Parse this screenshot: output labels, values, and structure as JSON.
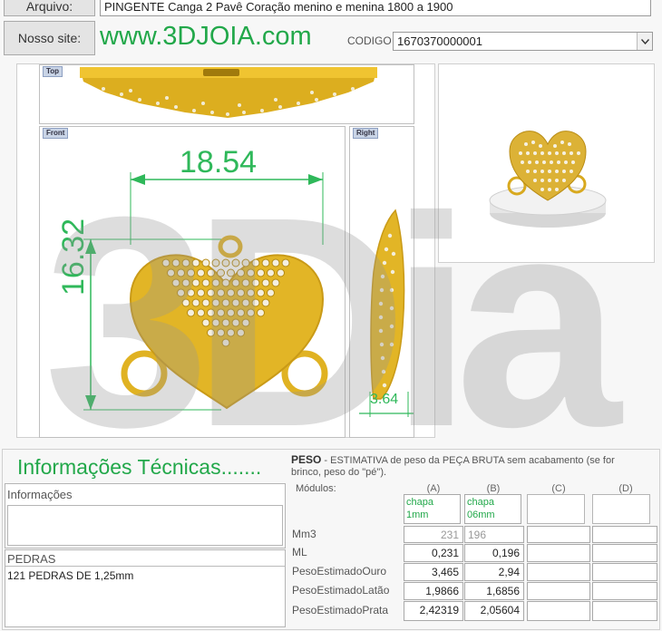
{
  "header": {
    "arquivo_label": "Arquivo:",
    "arquivo_value": "PINGENTE Canga 2 Pavê Coração menino e menina 1800 a 1900",
    "site_button": "Nosso site:",
    "site_url": "www.3DJOIA.com",
    "codigo_label": "CODIGO",
    "codigo_value": "1670370000001"
  },
  "viewports": {
    "top_label": "Top",
    "front_label": "Front",
    "right_label": "Right",
    "width_dim": "18.54",
    "height_dim": "16.32",
    "depth_dim": "3.64"
  },
  "watermark": "3Dia",
  "info": {
    "title": "Informações Técnicas.......",
    "informacoes_label": "Informações",
    "pedras_label": "PEDRAS",
    "pedras_value": "121 PEDRAS DE 1,25mm"
  },
  "peso": {
    "title": "PESO",
    "description": " -  ESTIMATIVA de peso da PEÇA BRUTA sem acabamento (se for brinco, peso do \"pé\").",
    "modulos_label": "Módulos:",
    "columns": [
      "(A)",
      "(B)",
      "(C)",
      "(D)"
    ],
    "chapa": [
      "chapa 1mm",
      "chapa 06mm"
    ],
    "rows": [
      {
        "label": "Mm3",
        "a": "231",
        "b": "196"
      },
      {
        "label": "ML",
        "a": "0,231",
        "b": "0,196"
      },
      {
        "label": "PesoEstimadoOuro",
        "a": "3,465",
        "b": "2,94"
      },
      {
        "label": "PesoEstimadoLatão",
        "a": "1,9866",
        "b": "1,6856"
      },
      {
        "label": "PesoEstimadoPrata",
        "a": "2,42319",
        "b": "2,05604"
      }
    ]
  },
  "colors": {
    "brand_green": "#22a84a",
    "gold": "#e2b526"
  }
}
